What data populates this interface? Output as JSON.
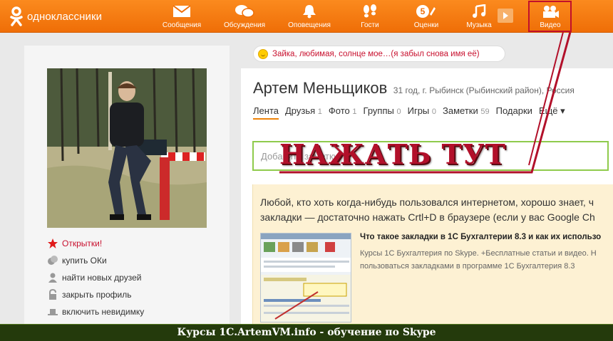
{
  "topbar": {
    "logo_text": "одноклассники",
    "nav": [
      {
        "label": "Сообщения",
        "icon": "envelope-icon"
      },
      {
        "label": "Обсуждения",
        "icon": "speech-bubbles-icon"
      },
      {
        "label": "Оповещения",
        "icon": "bell-icon"
      },
      {
        "label": "Гости",
        "icon": "footprints-icon"
      },
      {
        "label": "Оценки",
        "icon": "rating-5-icon"
      },
      {
        "label": "Музыка",
        "icon": "music-note-icon"
      },
      {
        "label": "Видео",
        "icon": "film-camera-icon"
      }
    ]
  },
  "status": {
    "text": "Зайка, любимая, солнце мое…(я забыл снова имя её)"
  },
  "profile": {
    "name": "Артем Меньщиков",
    "meta": "31 год, г. Рыбинск (Рыбинский район), Россия",
    "tabs": [
      {
        "label": "Лента",
        "count": ""
      },
      {
        "label": "Друзья",
        "count": "1"
      },
      {
        "label": "Фото",
        "count": "1"
      },
      {
        "label": "Группы",
        "count": "0"
      },
      {
        "label": "Игры",
        "count": "0"
      },
      {
        "label": "Заметки",
        "count": "59"
      },
      {
        "label": "Подарки",
        "count": ""
      },
      {
        "label": "Ещё ▾",
        "count": ""
      }
    ]
  },
  "side_menu": [
    {
      "label": "Открытки!",
      "icon": "star-icon"
    },
    {
      "label": "купить ОКи",
      "icon": "coins-icon"
    },
    {
      "label": "найти новых друзей",
      "icon": "person-icon"
    },
    {
      "label": "закрыть профиль",
      "icon": "lock-icon"
    },
    {
      "label": "включить невидимку",
      "icon": "hat-icon"
    }
  ],
  "note": {
    "placeholder": "Добавить заметку"
  },
  "callout": "НАЖАТЬ ТУТ",
  "post": {
    "line1": "Любой, кто хоть когда-нибудь пользовался интернетом, хорошо знает, ч",
    "line2": "закладки — достаточно нажать Crtl+D в браузере (если у вас Google Ch",
    "link_title": "Что такое закладки в 1С Бухгалтерии 8.3 и как их использо",
    "link_desc1": "Курсы 1С Бухгалтерия по Skype. +Бесплатные статьи и видео. Н",
    "link_desc2": "пользоваться закладками в программе 1С Бухгалтерия 8.3"
  },
  "footer": "Курсы 1С.ArtemVM.info - обучение по Skype",
  "colors": {
    "brand_orange": "#ee8208",
    "callout_red": "#b2102a",
    "input_green": "#8fcb4c",
    "footer_bg": "#243a0c"
  }
}
